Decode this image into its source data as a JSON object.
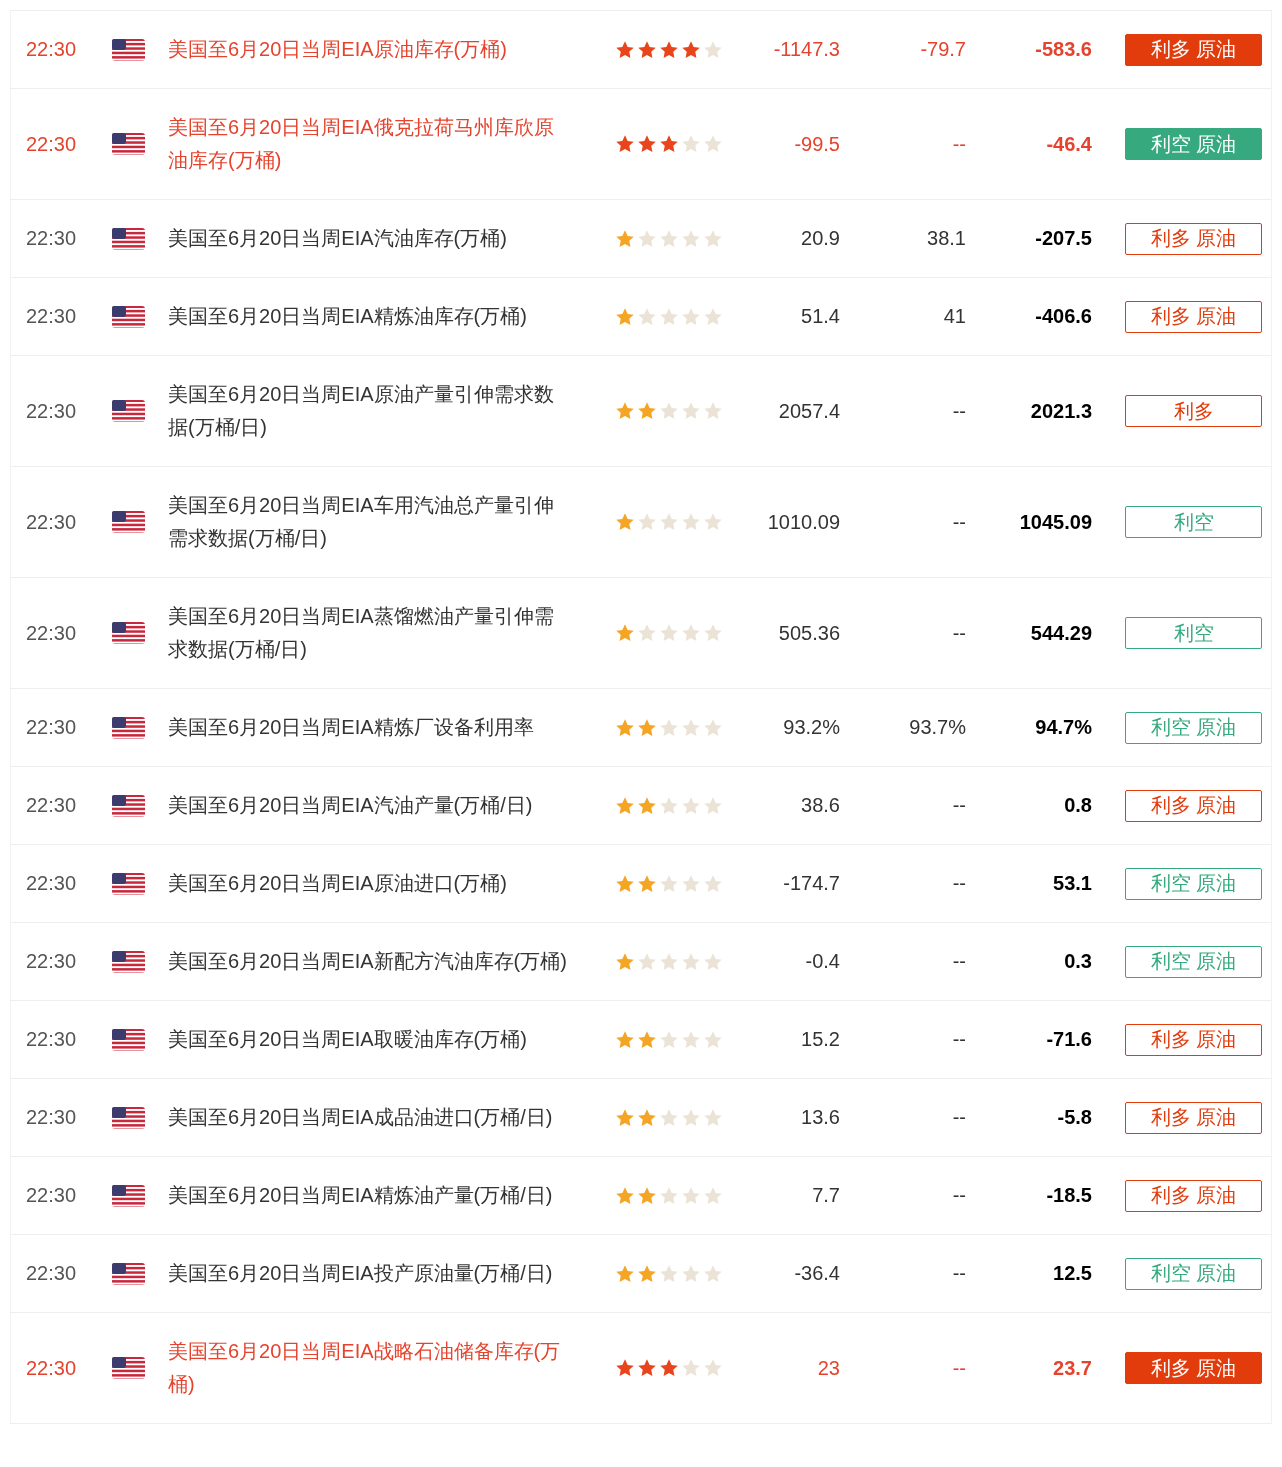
{
  "rows": [
    {
      "time": "22:30",
      "title": "美国至6月20日当周EIA原油库存(万桶)",
      "stars": 4,
      "actual": "-1147.3",
      "forecast": "-79.7",
      "previous": "-583.6",
      "tag": "利多 原油",
      "color": "#e23c0d",
      "important": true
    },
    {
      "time": "22:30",
      "title": "美国至6月20日当周EIA俄克拉荷马州库欣原油库存(万桶)",
      "stars": 3,
      "actual": "-99.5",
      "forecast": "--",
      "previous": "-46.4",
      "tag": "利空 原油",
      "color": "#36a97f",
      "important": true
    },
    {
      "time": "22:30",
      "title": "美国至6月20日当周EIA汽油库存(万桶)",
      "stars": 1,
      "actual": "20.9",
      "forecast": "38.1",
      "previous": "-207.5",
      "tag": "利多 原油",
      "color": "#e23c0d",
      "important": false
    },
    {
      "time": "22:30",
      "title": "美国至6月20日当周EIA精炼油库存(万桶)",
      "stars": 1,
      "actual": "51.4",
      "forecast": "41",
      "previous": "-406.6",
      "tag": "利多 原油",
      "color": "#e23c0d",
      "important": false
    },
    {
      "time": "22:30",
      "title": "美国至6月20日当周EIA原油产量引伸需求数据(万桶/日)",
      "stars": 2,
      "actual": "2057.4",
      "forecast": "--",
      "previous": "2021.3",
      "tag": "利多",
      "color": "#e23c0d",
      "important": false
    },
    {
      "time": "22:30",
      "title": "美国至6月20日当周EIA车用汽油总产量引伸需求数据(万桶/日)",
      "stars": 1,
      "actual": "1010.09",
      "forecast": "--",
      "previous": "1045.09",
      "tag": "利空",
      "color": "#36a97f",
      "important": false
    },
    {
      "time": "22:30",
      "title": "美国至6月20日当周EIA蒸馏燃油产量引伸需求数据(万桶/日)",
      "stars": 1,
      "actual": "505.36",
      "forecast": "--",
      "previous": "544.29",
      "tag": "利空",
      "color": "#36a97f",
      "important": false
    },
    {
      "time": "22:30",
      "title": "美国至6月20日当周EIA精炼厂设备利用率",
      "stars": 2,
      "actual": "93.2%",
      "forecast": "93.7%",
      "previous": "94.7%",
      "tag": "利空 原油",
      "color": "#36a97f",
      "important": false
    },
    {
      "time": "22:30",
      "title": "美国至6月20日当周EIA汽油产量(万桶/日)",
      "stars": 2,
      "actual": "38.6",
      "forecast": "--",
      "previous": "0.8",
      "tag": "利多 原油",
      "color": "#e23c0d",
      "important": false
    },
    {
      "time": "22:30",
      "title": "美国至6月20日当周EIA原油进口(万桶)",
      "stars": 2,
      "actual": "-174.7",
      "forecast": "--",
      "previous": "53.1",
      "tag": "利空 原油",
      "color": "#36a97f",
      "important": false
    },
    {
      "time": "22:30",
      "title": "美国至6月20日当周EIA新配方汽油库存(万桶)",
      "stars": 1,
      "actual": "-0.4",
      "forecast": "--",
      "previous": "0.3",
      "tag": "利空 原油",
      "color": "#36a97f",
      "important": false
    },
    {
      "time": "22:30",
      "title": "美国至6月20日当周EIA取暖油库存(万桶)",
      "stars": 2,
      "actual": "15.2",
      "forecast": "--",
      "previous": "-71.6",
      "tag": "利多 原油",
      "color": "#e23c0d",
      "important": false
    },
    {
      "time": "22:30",
      "title": "美国至6月20日当周EIA成品油进口(万桶/日)",
      "stars": 2,
      "actual": "13.6",
      "forecast": "--",
      "previous": "-5.8",
      "tag": "利多 原油",
      "color": "#e23c0d",
      "important": false
    },
    {
      "time": "22:30",
      "title": "美国至6月20日当周EIA精炼油产量(万桶/日)",
      "stars": 2,
      "actual": "7.7",
      "forecast": "--",
      "previous": "-18.5",
      "tag": "利多 原油",
      "color": "#e23c0d",
      "important": false
    },
    {
      "time": "22:30",
      "title": "美国至6月20日当周EIA投产原油量(万桶/日)",
      "stars": 2,
      "actual": "-36.4",
      "forecast": "--",
      "previous": "12.5",
      "tag": "利空 原油",
      "color": "#36a97f",
      "important": false
    },
    {
      "time": "22:30",
      "title": "美国至6月20日当周EIA战略石油储备库存(万桶)",
      "stars": 3,
      "actual": "23",
      "forecast": "--",
      "previous": "23.7",
      "tag": "利多 原油",
      "color": "#e23c0d",
      "important": true
    }
  ]
}
